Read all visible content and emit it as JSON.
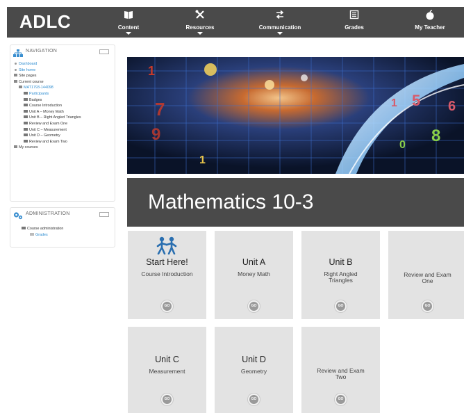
{
  "brand": "ADLC",
  "topnav": [
    {
      "label": "Content",
      "icon": "book-icon"
    },
    {
      "label": "Resources",
      "icon": "tools-icon"
    },
    {
      "label": "Communication",
      "icon": "swap-arrows-icon"
    },
    {
      "label": "Grades",
      "icon": "gradebook-icon"
    },
    {
      "label": "My Teacher",
      "icon": "apple-icon"
    }
  ],
  "navigation": {
    "title": "NAVIGATION",
    "items": [
      "Dashboard",
      "Site home",
      "Site pages",
      "Current course",
      "MAT1793-144098",
      "Participants",
      "Badges",
      "Course Introduction",
      "Unit A – Money Math",
      "Unit B – Right Angled Triangles",
      "Review and Exam One",
      "Unit C – Measurement",
      "Unit D – Geometry",
      "Review and Exam Two",
      "My courses"
    ]
  },
  "administration": {
    "title": "ADMINISTRATION",
    "items": [
      "Course administration",
      "Grades"
    ]
  },
  "course_title": "Mathematics 10-3",
  "tiles": [
    {
      "heading": "Start Here!",
      "sub": "Course Introduction",
      "go": "GO"
    },
    {
      "heading": "Unit A",
      "sub": "Money Math",
      "go": "GO"
    },
    {
      "heading": "Unit B",
      "sub": "Right Angled Triangles",
      "go": "GO"
    },
    {
      "heading": "",
      "sub": "Review and Exam One",
      "go": "GO"
    },
    {
      "heading": "Unit C",
      "sub": "Measurement",
      "go": "GO"
    },
    {
      "heading": "Unit D",
      "sub": "Geometry",
      "go": "GO"
    },
    {
      "heading": "",
      "sub": "Review and Exam Two",
      "go": "GO"
    }
  ],
  "banner_digits": [
    "1",
    "7",
    "9",
    "5",
    "1",
    "8",
    "0",
    "6",
    "1"
  ],
  "colors": {
    "topbar": "#4a4a4a",
    "link": "#2a8bd0",
    "tile": "#e3e3e3",
    "accent_icon": "#2a6fb0"
  }
}
